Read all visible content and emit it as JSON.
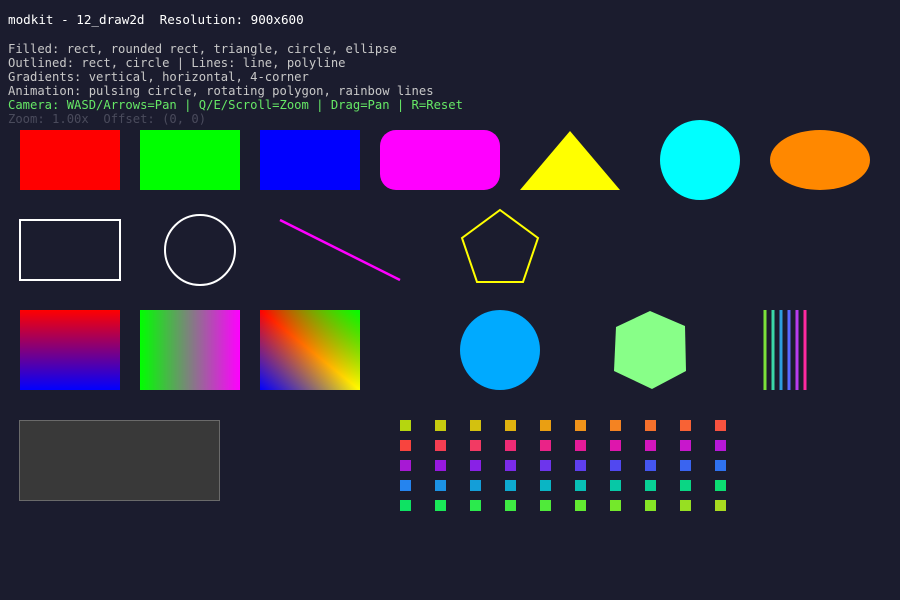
{
  "hud": {
    "title": "modkit - 12_draw2d  Resolution: 900x600",
    "lines": [
      {
        "text": "Filled: rect, rounded rect, triangle, circle, ellipse",
        "color": "#c8c8c8"
      },
      {
        "text": "Outlined: rect, circle | Lines: line, polyline",
        "color": "#c8c8c8"
      },
      {
        "text": "Gradients: vertical, horizontal, 4-corner",
        "color": "#c8c8c8"
      },
      {
        "text": "Animation: pulsing circle, rotating polygon, rainbow lines",
        "color": "#c8c8c8"
      },
      {
        "text": "Camera: WASD/Arrows=Pan | Q/E/Scroll=Zoom | Drag=Pan | R=Reset",
        "color": "#66e866"
      },
      {
        "text": "Zoom: 1.00x  Offset: (0, 0)",
        "color": "#4a4b5c"
      }
    ]
  },
  "colors": {
    "background": "#1b1c2e",
    "filled_rect_1": "#ff0000",
    "filled_rect_2": "#00ff00",
    "filled_rect_3": "#0000ff",
    "rounded_rect": "#ff00ff",
    "triangle": "#ffff00",
    "circle": "#00ffff",
    "ellipse": "#ff8800",
    "outline_rect": "#ffffff",
    "outline_circle": "#ffffff",
    "line": "#ff00ff",
    "polyline": "#ffff00",
    "pulsing_circle": "#00aaff",
    "hexagon": "#88ff88",
    "gray_panel_fill": "#393939",
    "gray_panel_border": "#6a6a6a"
  },
  "rainbow_lines": [
    "#7be23a",
    "#3bd8a8",
    "#2e9ee0",
    "#5a68ff",
    "#b83cf0",
    "#ff2aa0"
  ],
  "swatch_grid": [
    [
      "#b5d60f",
      "#c6cb0f",
      "#d3c10f",
      "#e0b20f",
      "#ea9f12",
      "#f0931a",
      "#f48322",
      "#f6712c",
      "#f86235",
      "#f8523f"
    ],
    [
      "#f8443e",
      "#f53e52",
      "#f23a63",
      "#ee2b75",
      "#ea2387",
      "#e51b98",
      "#de16ac",
      "#d316bd",
      "#c817cc",
      "#b818d9"
    ],
    [
      "#a719d4",
      "#9719df",
      "#8921e6",
      "#7b2be9",
      "#6d35ec",
      "#5f3fee",
      "#5148f0",
      "#4556f0",
      "#3a64f0",
      "#2f72ef"
    ],
    [
      "#2584ef",
      "#1c92e4",
      "#149ed8",
      "#0eaad0",
      "#0ab5c4",
      "#08bfb5",
      "#07c8a6",
      "#08d095",
      "#0ad684",
      "#0cdd72"
    ],
    [
      "#0ee263",
      "#1ae858",
      "#2bea4d",
      "#3eea43",
      "#50ea3a",
      "#62ea31",
      "#74e82b",
      "#86e426",
      "#97df22",
      "#a8da20"
    ]
  ]
}
